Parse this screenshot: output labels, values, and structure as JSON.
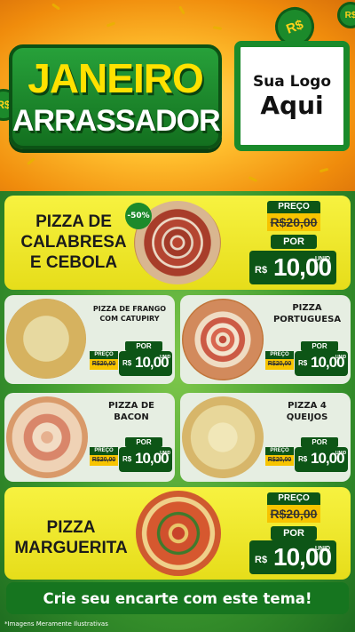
{
  "header": {
    "title_line1": "JANEIRO",
    "title_line2": "ARRASSADOR",
    "logo_line1": "Sua Logo",
    "logo_line2": "Aqui",
    "coin_symbol": "R$"
  },
  "labels": {
    "preco": "PREÇO",
    "por": "POR",
    "currency": "R$",
    "unit": "UNID"
  },
  "featured_top": {
    "name_line1": "PIZZA DE",
    "name_line2": "CALABRESA",
    "name_line3": "E CEBOLA",
    "discount": "-50%",
    "old_price": "R$20,00",
    "new_price": "10,00"
  },
  "grid": [
    {
      "name_line1": "PIZZA DE FRANGO",
      "name_line2": "COM CATUPIRY",
      "old_price": "R$20,00",
      "new_price": "10,00"
    },
    {
      "name_line1": "PIZZA",
      "name_line2": "PORTUGUESA",
      "old_price": "R$20,00",
      "new_price": "10,00"
    },
    {
      "name_line1": "PIZZA DE",
      "name_line2": "BACON",
      "old_price": "R$20,00",
      "new_price": "10,00"
    },
    {
      "name_line1": "PIZZA 4",
      "name_line2": "QUEIJOS",
      "old_price": "R$20,00",
      "new_price": "10,00"
    }
  ],
  "featured_bottom": {
    "name_line1": "PIZZA",
    "name_line2": "MARGUERITA",
    "old_price": "R$20,00",
    "new_price": "10,00"
  },
  "footer": {
    "cta": "Crie seu encarte com este tema!",
    "disclaimer": "*Imagens Meramente Ilustrativas"
  },
  "colors": {
    "brand_green": "#1c8a2b",
    "dark_green": "#0d5516",
    "title_yellow": "#ffe100",
    "card_yellow": "#f2ec30",
    "old_price_tag": "#f7c400"
  }
}
